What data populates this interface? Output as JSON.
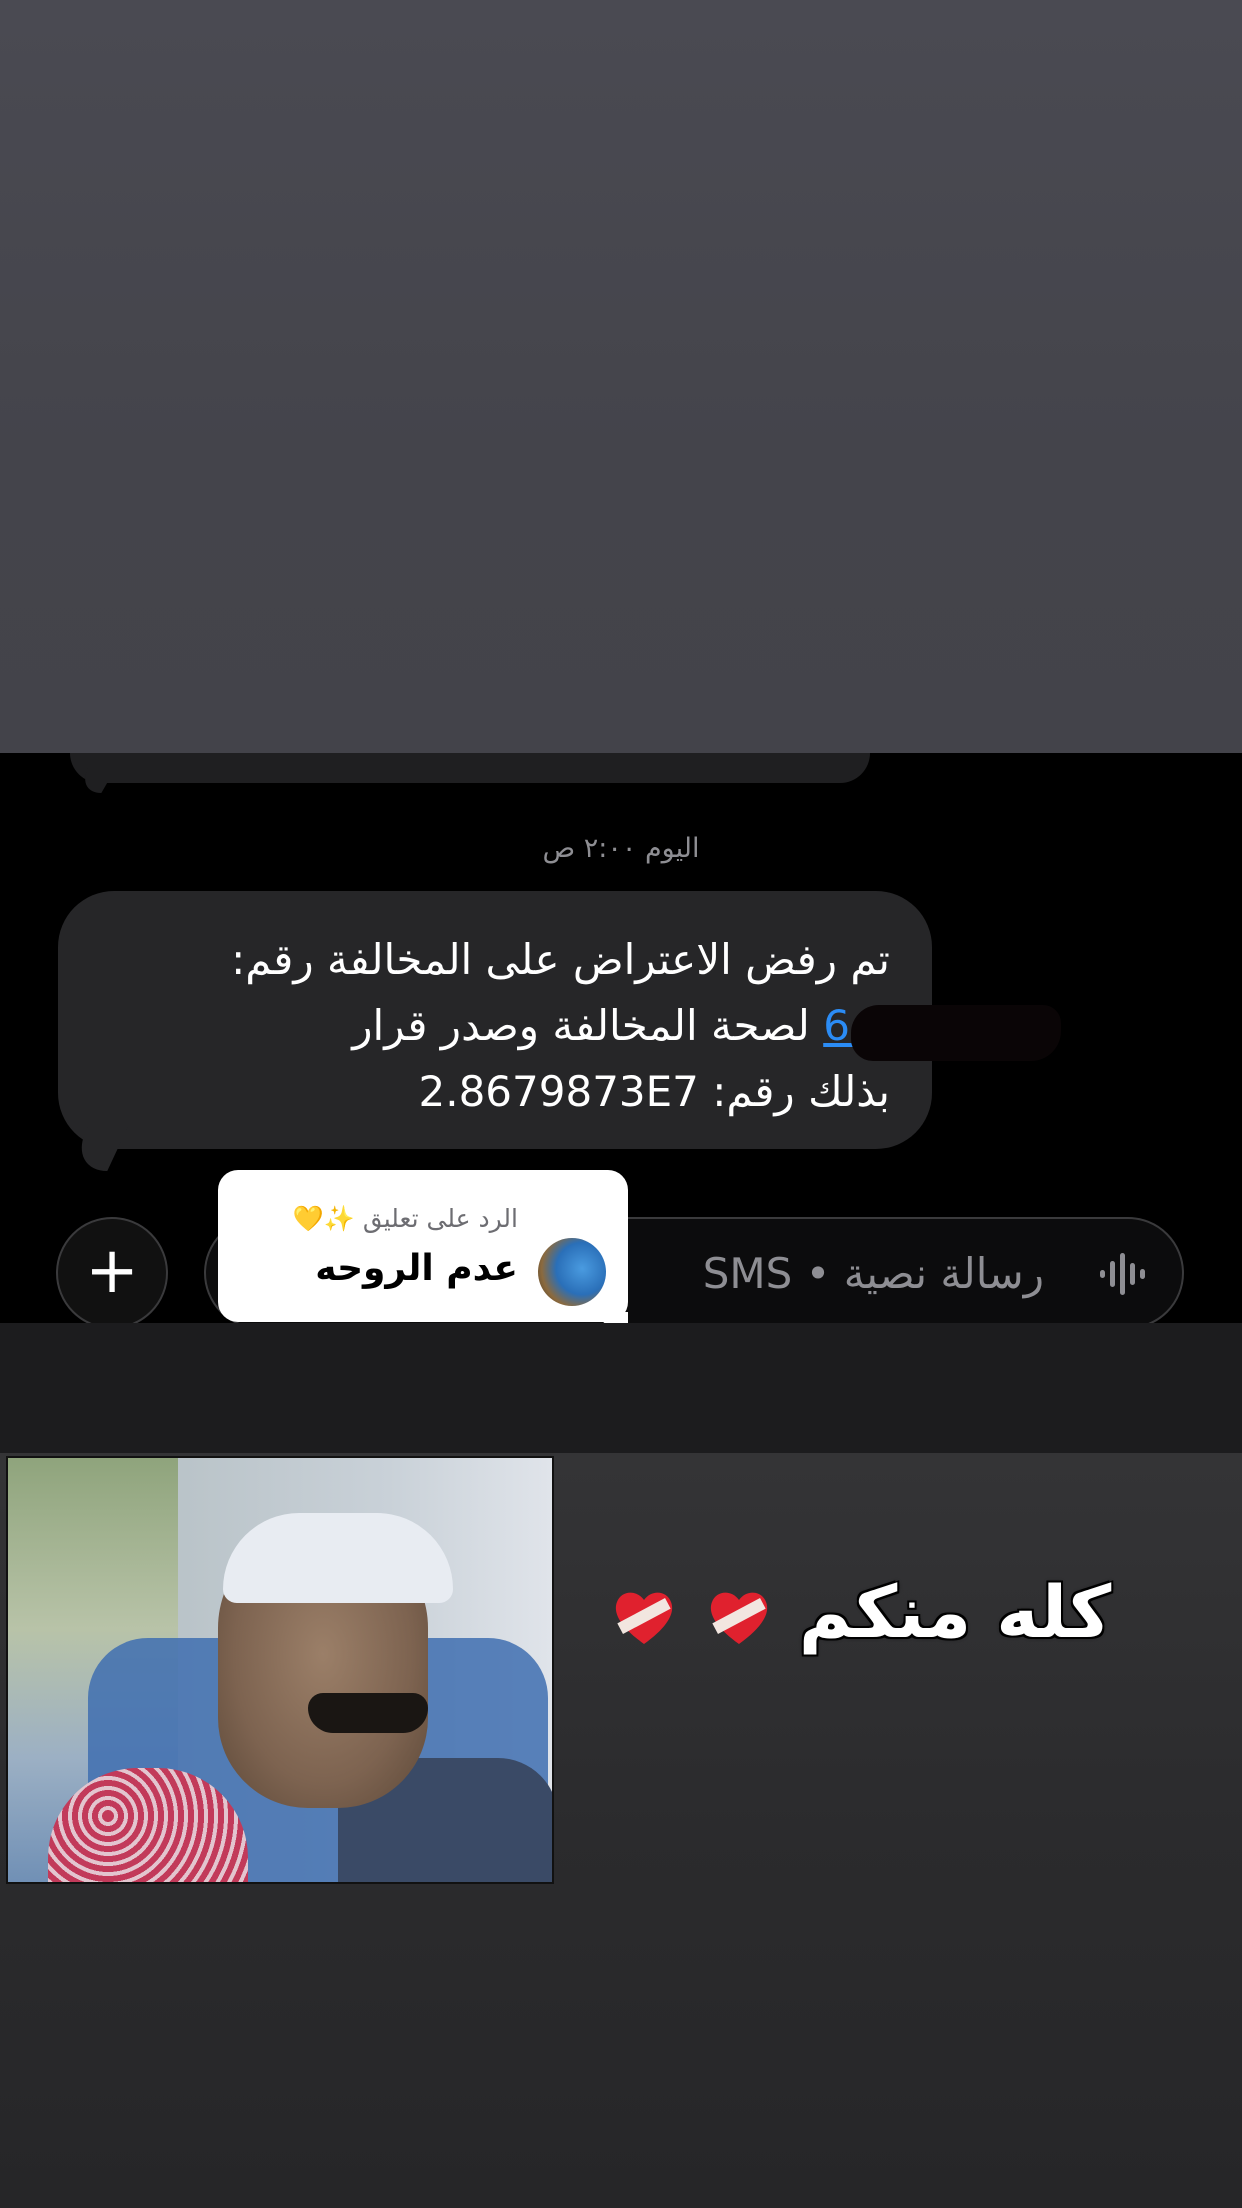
{
  "sms": {
    "timestamp": "اليوم ٢:٠٠ ص",
    "message_line1": "تم رفض الاعتراض على المخالفة رقم:",
    "message_number_visible": "6            3",
    "message_line2_text": "لصحة المخالفة وصدر قرار",
    "message_line3": "بذلك رقم: 2.8679873E7"
  },
  "composer": {
    "placeholder": "رسالة نصية • SMS",
    "add_icon": "plus-icon",
    "mic_icon": "waveform-icon"
  },
  "reply_sticker": {
    "label": "الرد على تعليق ✨💛",
    "username": "عدم الروحه"
  },
  "story_caption": {
    "text": "كله منكم",
    "emoji": "❤️‍🩹❤️‍🩹"
  },
  "colors": {
    "link": "#2b8cf5",
    "bubble": "#262628",
    "background_top": "#4a4a52"
  }
}
